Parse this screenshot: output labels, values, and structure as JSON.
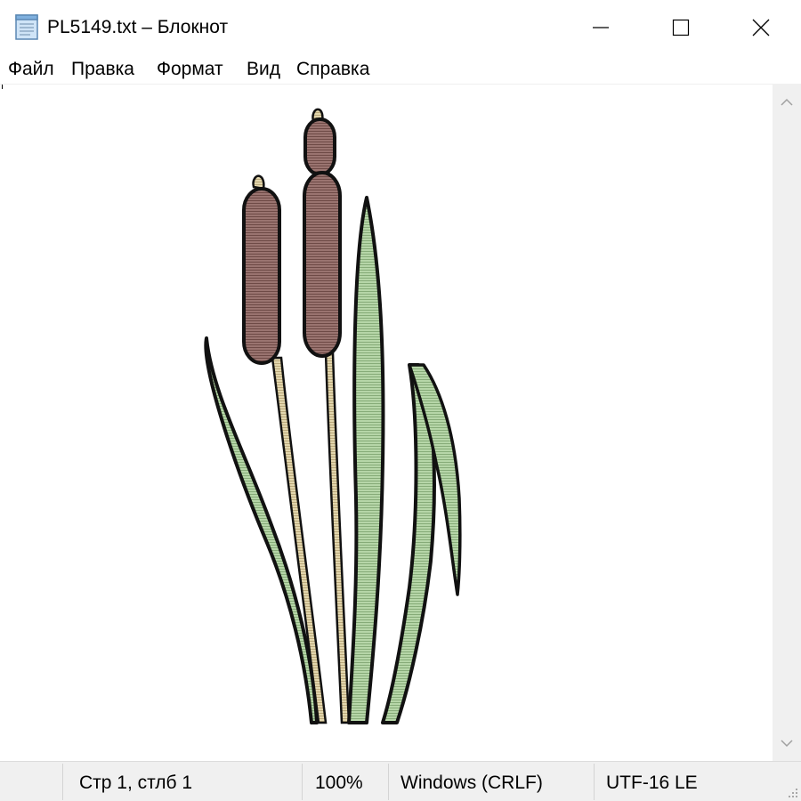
{
  "window": {
    "title": "PL5149.txt – Блокнот",
    "icon": "notepad-icon"
  },
  "menu": {
    "items": [
      {
        "label": "Файл"
      },
      {
        "label": "Правка"
      },
      {
        "label": "Формат"
      },
      {
        "label": "Вид"
      },
      {
        "label": "Справка"
      }
    ]
  },
  "status": {
    "position": "Стр 1, стлб 1",
    "zoom": "100%",
    "line_endings": "Windows (CRLF)",
    "encoding": "UTF-16 LE"
  },
  "colors": {
    "cattail_brown": "#8b6560",
    "leaf_green": "#a9cd9e",
    "stem_tan": "#d8c99a",
    "outline": "#111111",
    "chrome_gray": "#f0f0f0"
  }
}
